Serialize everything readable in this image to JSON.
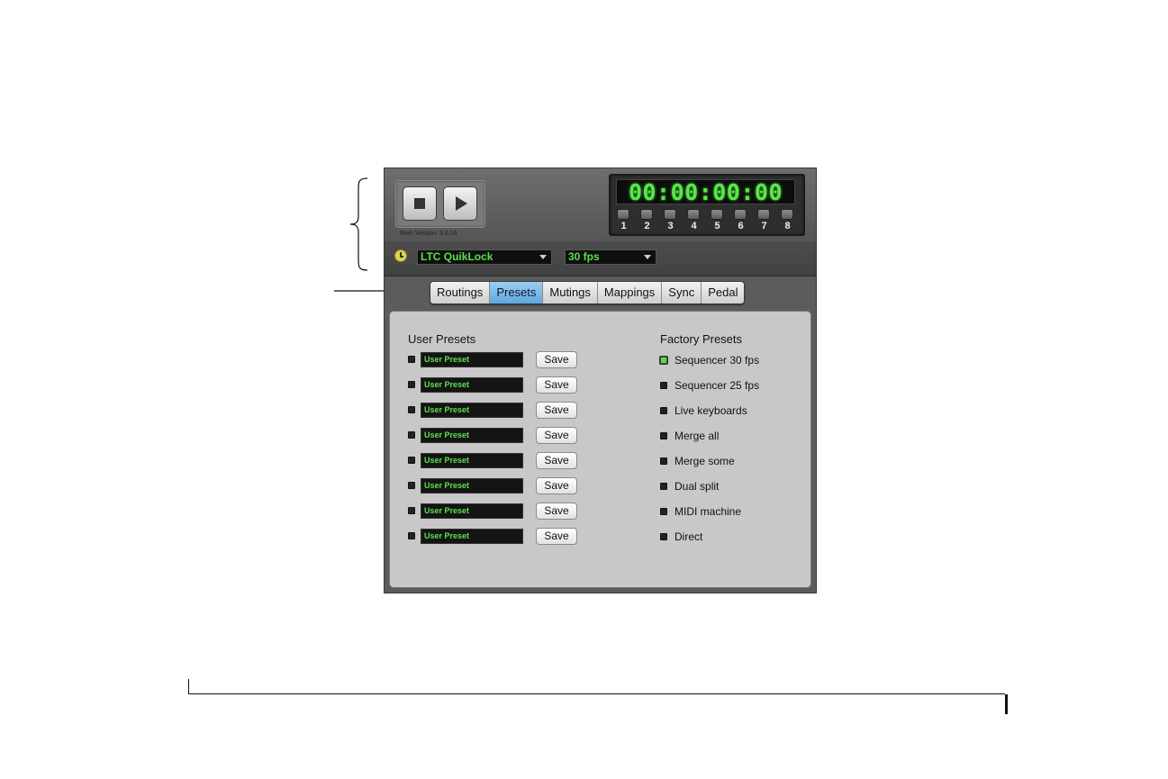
{
  "transport": {
    "stop_icon": "stop-icon",
    "play_icon": "play-icon",
    "rom_version": "Rom Version: 3.0.16"
  },
  "timecode": {
    "display": "00:00:00:00",
    "ports": [
      "1",
      "2",
      "3",
      "4",
      "5",
      "6",
      "7",
      "8"
    ]
  },
  "sync": {
    "source": "LTC QuikLock",
    "frame_rate": "30 fps"
  },
  "tabs": [
    "Routings",
    "Presets",
    "Mutings",
    "Mappings",
    "Sync",
    "Pedal"
  ],
  "active_tab": "Presets",
  "user_presets": {
    "title": "User Presets",
    "save_label": "Save",
    "items": [
      "User Preset",
      "User Preset",
      "User Preset",
      "User Preset",
      "User Preset",
      "User Preset",
      "User Preset",
      "User Preset"
    ]
  },
  "factory_presets": {
    "title": "Factory Presets",
    "items": [
      "Sequencer 30 fps",
      "Sequencer 25 fps",
      "Live keyboards",
      "Merge all",
      "Merge some",
      "Dual split",
      "MIDI machine",
      "Direct"
    ],
    "selected_index": 0
  },
  "colors": {
    "led_green": "#5ae34c",
    "active_tab": "#5da7df",
    "panel_bg": "#c8c8c8"
  }
}
